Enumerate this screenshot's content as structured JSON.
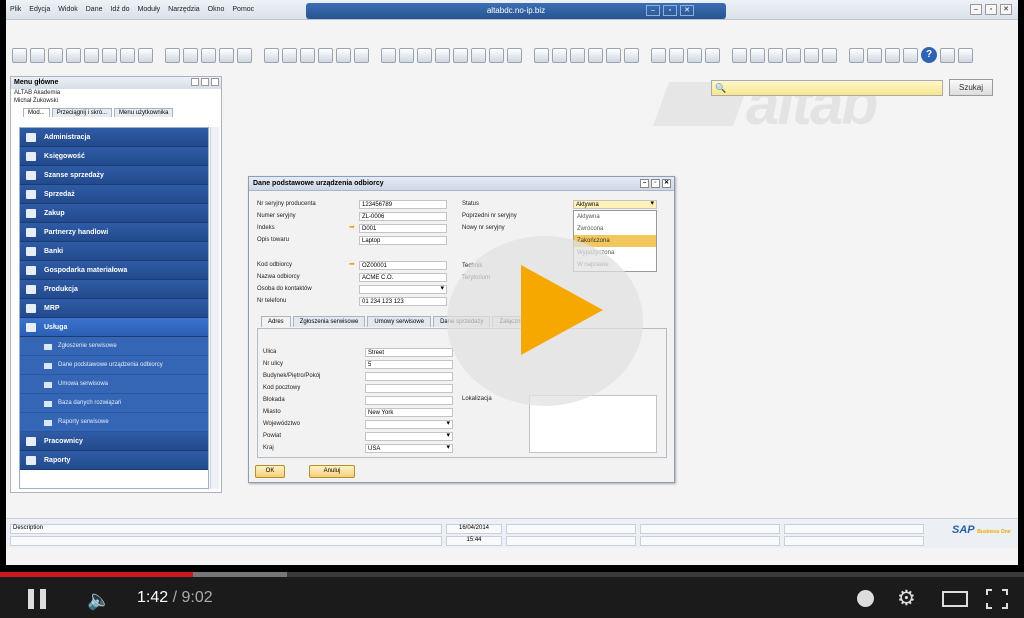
{
  "app": {
    "menu": [
      "Plik",
      "Edycja",
      "Widok",
      "Dane",
      "Idź do",
      "Moduły",
      "Narzędzia",
      "Okno",
      "Pomoc"
    ],
    "title": "altabdc.no-ip.biz",
    "brand_logo_text": "altab",
    "search_button": "Szukaj"
  },
  "left_panel": {
    "title": "Menu główne",
    "company": "ALTAB Akademia",
    "user": "Michał Żukowski",
    "tabs": [
      "Mod...",
      "Przeciągnij i skró...",
      "Menu użytkownika"
    ],
    "modules": [
      {
        "label": "Administracja",
        "icon": "gear-icon"
      },
      {
        "label": "Księgowość",
        "icon": "ledger-icon"
      },
      {
        "label": "Szanse sprzedaży",
        "icon": "chart-icon"
      },
      {
        "label": "Sprzedaż",
        "icon": "tag-icon"
      },
      {
        "label": "Zakup",
        "icon": "cart-icon"
      },
      {
        "label": "Partnerzy handlowi",
        "icon": "people-icon"
      },
      {
        "label": "Banki",
        "icon": "bank-icon"
      },
      {
        "label": "Gospodarka materiałowa",
        "icon": "boxes-icon"
      },
      {
        "label": "Produkcja",
        "icon": "cog-icon"
      },
      {
        "label": "MRP",
        "icon": "mrp-icon"
      },
      {
        "label": "Usługa",
        "icon": "wrench-icon"
      }
    ],
    "service_items": [
      "Zgłoszenie serwisowe",
      "Dane podstawowe urządzenia odbiorcy",
      "Umowa serwisowa",
      "Baza danych rozwiązań",
      "Raporty serwisowe"
    ],
    "modules_after": [
      {
        "label": "Pracownicy",
        "icon": "employees-icon"
      },
      {
        "label": "Raporty",
        "icon": "reports-icon"
      }
    ]
  },
  "dialog": {
    "title": "Dane podstawowe urządzenia odbiorcy",
    "left_fields": [
      {
        "label": "Nr seryjny producenta",
        "value": "123456789"
      },
      {
        "label": "Numer seryjny",
        "value": "ZL-0006"
      },
      {
        "label": "Indeks",
        "value": "D001"
      },
      {
        "label": "Opis towaru",
        "value": "Laptop"
      }
    ],
    "customer_fields": [
      {
        "label": "Kod odbiorcy",
        "value": "OZ00001"
      },
      {
        "label": "Nazwa odbiorcy",
        "value": "ACME C.O."
      },
      {
        "label": "Osoba do kontaktów",
        "value": ""
      },
      {
        "label": "Nr telefonu",
        "value": "01 234 123 123"
      }
    ],
    "right_labels": [
      "Status",
      "Poprzedni nr seryjny",
      "Nowy nr seryjny",
      "Technik",
      "Terytorium"
    ],
    "status_value": "Aktywna",
    "status_options": [
      "Aktywna",
      "Zwrócona",
      "Zakończona",
      "Wypożyczona",
      "W naprawie"
    ],
    "tabs": [
      "Adres",
      "Zgłoszenia serwisowe",
      "Umowy serwisowe",
      "Dane sprzedaży",
      "Załączniki"
    ],
    "address_fields": [
      {
        "label": "Ulica",
        "value": "Street"
      },
      {
        "label": "Nr ulicy",
        "value": "5"
      },
      {
        "label": "Budynek/Piętro/Pokój",
        "value": ""
      },
      {
        "label": "Kod pocztowy",
        "value": ""
      },
      {
        "label": "Blokada",
        "value": ""
      },
      {
        "label": "Miasto",
        "value": "New York"
      },
      {
        "label": "Województwo",
        "value": ""
      },
      {
        "label": "Powiat",
        "value": ""
      },
      {
        "label": "Kraj",
        "value": "USA"
      }
    ],
    "location_label": "Lokalizacja",
    "ok_button": "OK",
    "cancel_button": "Anuluj"
  },
  "statusbar": {
    "description": "Description",
    "date": "16/04/2014",
    "time": "15:44",
    "sap_logo": "SAP",
    "sap_sub": "Business One"
  },
  "player": {
    "current_time": "1:42",
    "separator": " / ",
    "duration": "9:02",
    "played_fraction": 0.188,
    "loaded_fraction": 0.28
  }
}
